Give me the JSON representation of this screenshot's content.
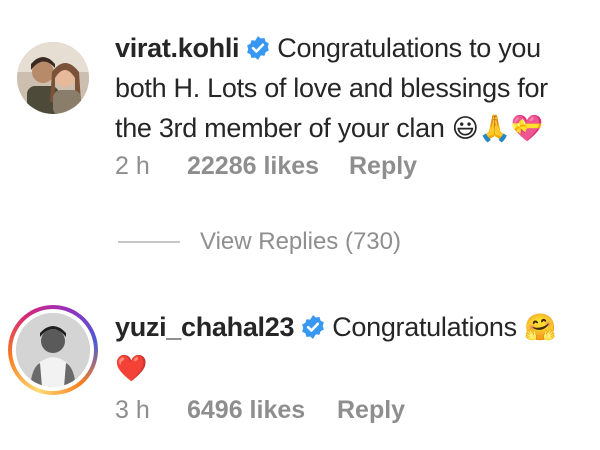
{
  "comments": [
    {
      "username": "virat.kohli",
      "text": "Congratulations to you both H. Lots of love and blessings for the 3rd member of your clan",
      "emojis": "😃🙏💝",
      "time": "2 h",
      "likes": "22286 likes",
      "reply_label": "Reply",
      "view_replies": "View Replies (730)"
    },
    {
      "username": "yuzi_chahal23",
      "text": "Congratulations",
      "emojis": "🤗",
      "emoji_line2": "❤️",
      "time": "3 h",
      "likes": "6496 likes",
      "reply_label": "Reply"
    }
  ],
  "colors": {
    "verified": "#3897f0",
    "meta": "#8e8e8e",
    "text": "#262626",
    "heart": "#e0245e"
  }
}
